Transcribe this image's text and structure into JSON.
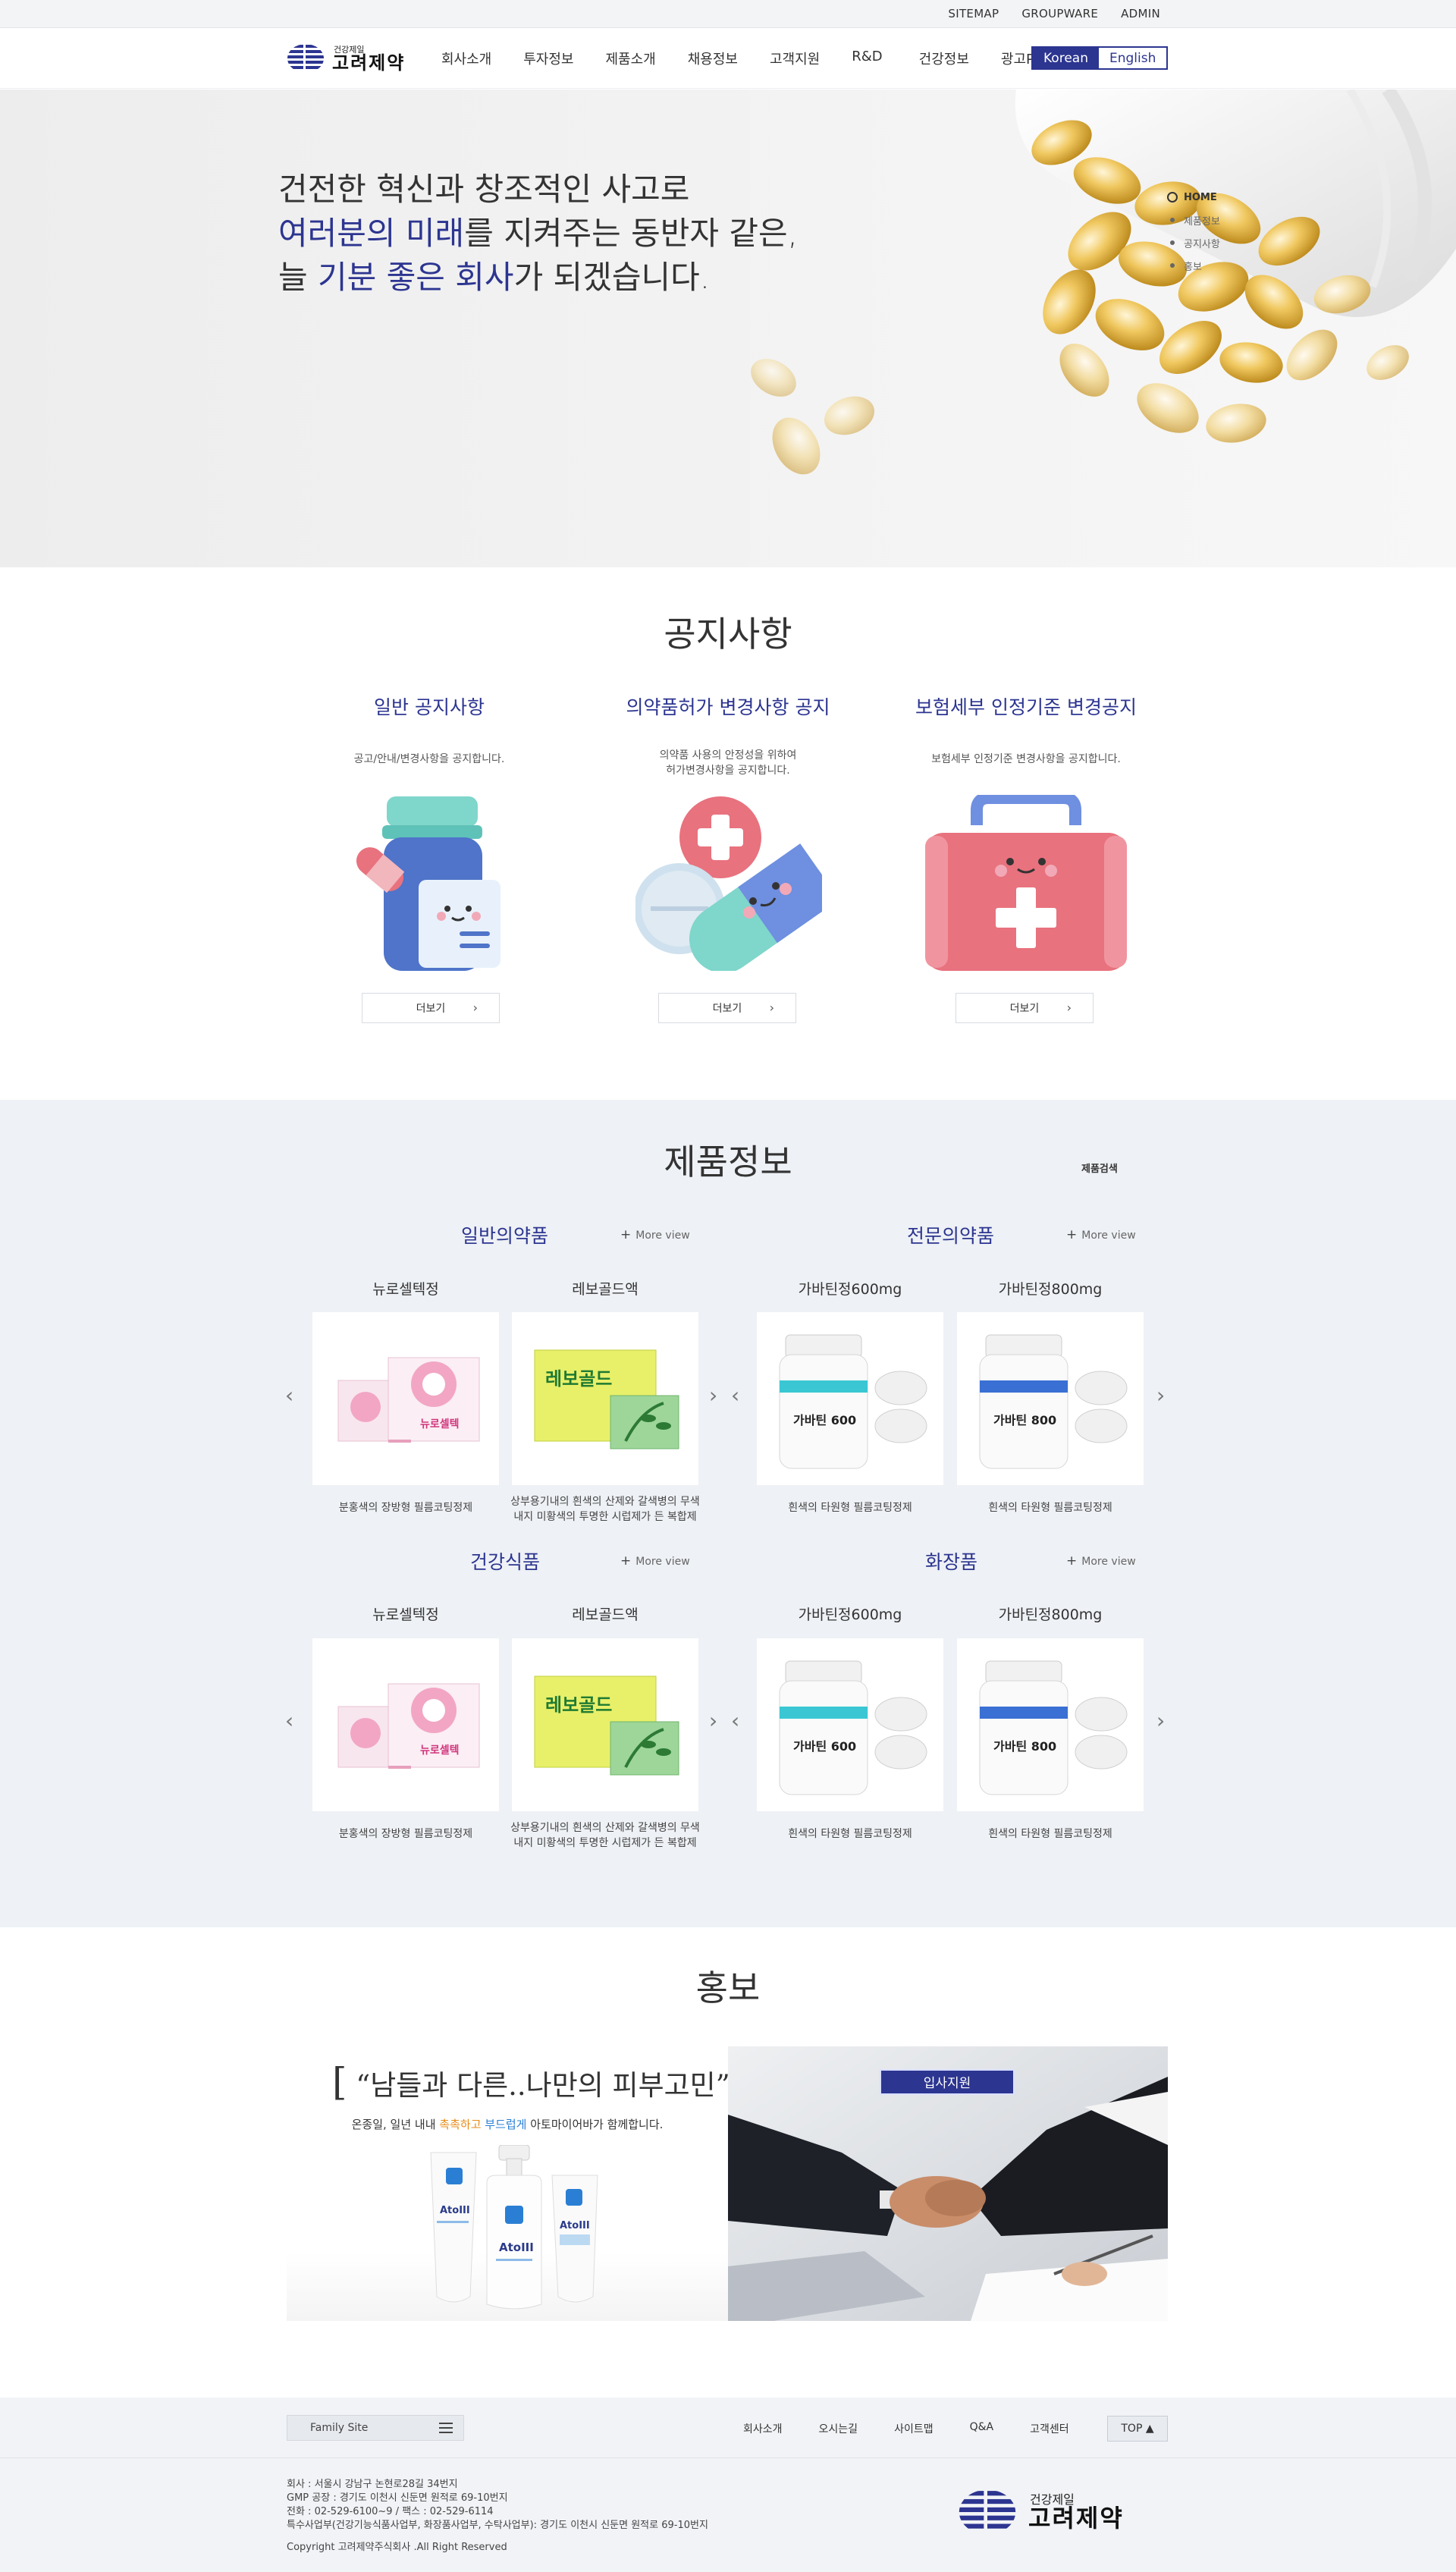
{
  "util": {
    "sitemap": "SITEMAP",
    "groupware": "GROUPWARE",
    "admin": "ADMIN"
  },
  "header": {
    "logo_small": "건강제일",
    "logo_big": "고려제약",
    "nav": [
      "회사소개",
      "투자정보",
      "제품소개",
      "채용정보",
      "고객지원",
      "R&D",
      "건강정보",
      "광고PR"
    ],
    "lang_korean": "Korean",
    "lang_english": "English"
  },
  "hero": {
    "line1": "건전한 혁신과 창조적인 사고로",
    "line2_hl": "여러분의 미래",
    "line2_rest": "를 지켜주는 동반자 같은,",
    "line3_pre": "늘 ",
    "line3_hl1": "기분 좋은",
    "line3_mid": " ",
    "line3_hl2": "회사",
    "line3_rest": "가 되겠습니다.",
    "nav": [
      "HOME",
      "제품정보",
      "공지사항",
      "홍보"
    ]
  },
  "notice": {
    "title": "공지사항",
    "columns": [
      {
        "title": "일반 공지사항",
        "desc": "공고/안내/변경사항을 공지합니다.",
        "more": "더보기"
      },
      {
        "title": "의약품허가 변경사항 공지",
        "desc": "의약품 사용의 안정성을 위하여\n허가변경사항을 공지합니다.",
        "more": "더보기"
      },
      {
        "title": "보험세부 인정기준 변경공지",
        "desc": "보험세부 인정기준 변경사항을 공지합니다.",
        "more": "더보기"
      }
    ]
  },
  "products": {
    "title": "제품정보",
    "search": "제품검색",
    "more_view": "More view",
    "categories": [
      {
        "title": "일반의약품",
        "items": [
          {
            "name": "뉴로셀텍정",
            "desc": "분홍색의 장방형 필름코팅정제"
          },
          {
            "name": "레보골드액",
            "desc": "상부용기내의 흰색의 산제와 갈색병의 무색\n내지 미황색의 투명한 시럽제가 든 복합제"
          }
        ]
      },
      {
        "title": "전문의약품",
        "items": [
          {
            "name": "가바틴정600mg",
            "desc": "흰색의 타원형 필름코팅정제"
          },
          {
            "name": "가바틴정800mg",
            "desc": "흰색의 타원형 필름코팅정제"
          }
        ]
      },
      {
        "title": "건강식품",
        "items": [
          {
            "name": "뉴로셀텍정",
            "desc": "분홍색의 장방형 필름코팅정제"
          },
          {
            "name": "레보골드액",
            "desc": "상부용기내의 흰색의 산제와 갈색병의 무색\n내지 미황색의 투명한 시럽제가 든 복합제"
          }
        ]
      },
      {
        "title": "화장품",
        "items": [
          {
            "name": "가바틴정600mg",
            "desc": "흰색의 타원형 필름코팅정제"
          },
          {
            "name": "가바틴정800mg",
            "desc": "흰색의 타원형 필름코팅정제"
          }
        ]
      }
    ],
    "box_labels": {
      "neuro": "뉴로셀텍",
      "levo": "레보골드",
      "gaba600": "가바틴 600",
      "gaba800": "가바틴 800"
    }
  },
  "pr": {
    "title": "홍보",
    "quote": "“남들과 다른..나만의 피부고민”",
    "sub_pre": "온종일, 일년 내내 ",
    "sub_o": "촉촉하고",
    "sub_mid": " ",
    "sub_b": "부드럽게",
    "sub_post": " 아토마이어바가 함께합니다.",
    "product_name": "AtoIII",
    "recruit": "입사지원"
  },
  "footer": {
    "family": "Family Site",
    "nav": [
      "회사소개",
      "오시는길",
      "사이트맵",
      "Q&A",
      "고객센터"
    ],
    "top": "TOP ▲",
    "addr": [
      "회사 : 서울시 강남구 논현로28길 34번지",
      "GMP 공장 : 경기도 이천시 신둔면 원적로 69-10번지",
      "전화 : 02-529-6100~9 / 팩스 : 02-529-6114",
      "특수사업부(건강기능식품사업부, 화장품사업부, 수탁사업부): 경기도 이천시 신둔면 원적로 69-10번지"
    ],
    "copyright": "Copyright 고려제약주식회사 .All Right Reserved",
    "logo_small": "건강제일",
    "logo_big": "고려제약"
  },
  "colors": {
    "brand": "#2c3590",
    "bg_products": "#eef1f5"
  }
}
